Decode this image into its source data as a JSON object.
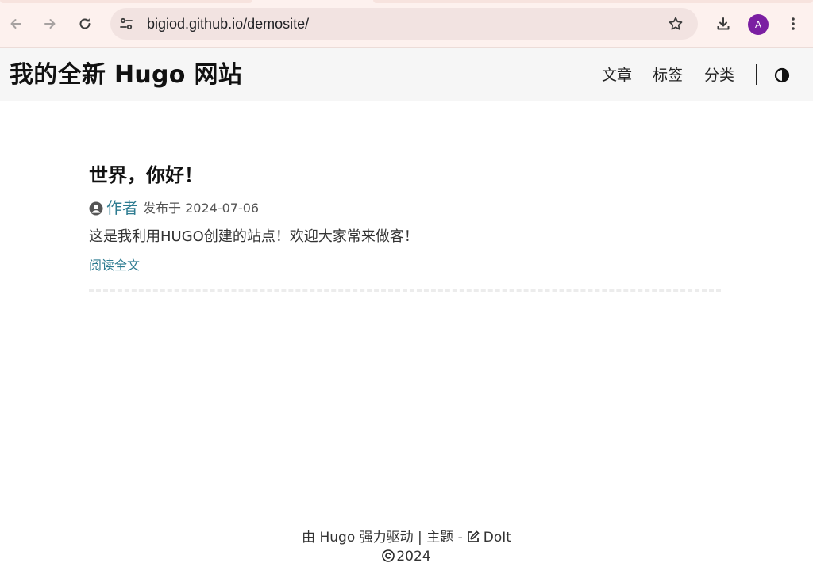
{
  "browser": {
    "url": "bigiod.github.io/demosite/",
    "profile_initial": "A",
    "profile_color": "#7b1fa2",
    "icons": [
      "back-arrow-icon",
      "forward-arrow-icon",
      "reload-icon",
      "site-settings-icon",
      "bookmark-star-icon",
      "download-icon",
      "more-vert-icon"
    ]
  },
  "header": {
    "site_title": "我的全新 Hugo 网站",
    "menu": [
      {
        "label": "文章"
      },
      {
        "label": "标签"
      },
      {
        "label": "分类"
      }
    ],
    "theme_toggle_icon": "theme-toggle-icon"
  },
  "post": {
    "title": "世界，你好！",
    "author": "作者",
    "published_prefix": "发布于",
    "date": "2024-07-06",
    "summary": "这是我利用HUGO创建的站点！欢迎大家常来做客！",
    "read_more": "阅读全文"
  },
  "footer": {
    "powered_prefix": "由",
    "hugo": "Hugo",
    "powered_suffix": "强力驱动",
    "separator": "|",
    "theme_label": "主题 -",
    "theme_name": "DoIt",
    "year": "2024"
  },
  "colors": {
    "accent": "#2e7c91",
    "header_bg": "#f6f6f6",
    "chrome_bg": "#fdf1ee",
    "omnibox_bg": "#f2e3e1"
  }
}
